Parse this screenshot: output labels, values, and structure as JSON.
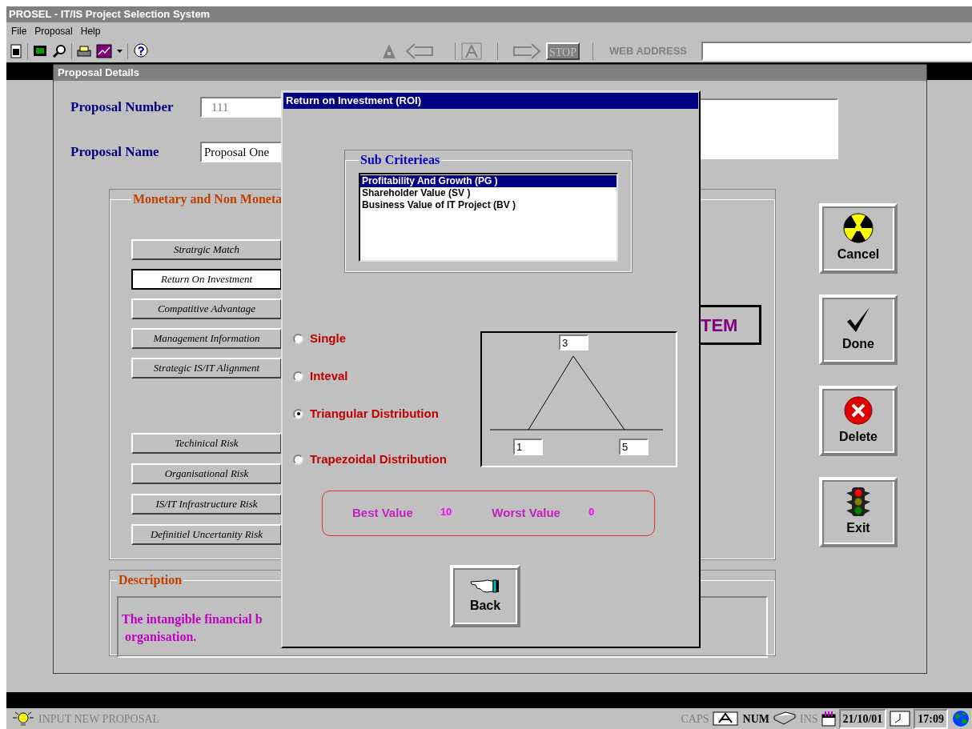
{
  "window": {
    "title": "PROSEL - IT/IS Project Selection System"
  },
  "menu": [
    {
      "label": "File"
    },
    {
      "label": "Proposal"
    },
    {
      "label": "Help"
    }
  ],
  "toolbar": {
    "stop_button": "STOP",
    "web_address_label": "WEB ADDRESS"
  },
  "proposal_window": {
    "title": "Proposal Details",
    "fields": [
      {
        "label": "Proposal Number",
        "value": "111",
        "disabled": true
      },
      {
        "label": "Proposal Name",
        "value": "Proposal One",
        "disabled": false
      }
    ],
    "criteria_group": {
      "title": "Monetary and Non Moneta",
      "benefit_buttons": [
        {
          "label": "Stratrgic Match",
          "selected": false
        },
        {
          "label": "Return On Investment",
          "selected": true
        },
        {
          "label": "Compatitive Advantage",
          "selected": false
        },
        {
          "label": "Management Information",
          "selected": false
        },
        {
          "label": "Strategic IS/IT Alignment",
          "selected": false
        }
      ],
      "risk_buttons": [
        {
          "label": "Techinical Risk",
          "selected": false
        },
        {
          "label": "Organisational Risk",
          "selected": false
        },
        {
          "label": "IS/IT Infrastructure Risk",
          "selected": false
        },
        {
          "label": "Definitiel Uncertanity Risk",
          "selected": false
        }
      ],
      "banner_text": "TEM"
    },
    "description": {
      "title": "Description",
      "lines": [
        "The intangible financial b",
        "organisation."
      ]
    },
    "actions": [
      {
        "label": "Cancel",
        "kind": "cancel"
      },
      {
        "label": "Done",
        "kind": "done"
      },
      {
        "label": "Delete",
        "kind": "delete"
      },
      {
        "label": "Exit",
        "kind": "exit"
      }
    ]
  },
  "dialog": {
    "title": "Return on Investment (ROI)",
    "sub_criteria": {
      "title": "Sub Criterieas",
      "items": [
        {
          "label": "Profitability And Growth (PG )",
          "selected": true
        },
        {
          "label": "Shareholder Value (SV )",
          "selected": false
        },
        {
          "label": "Business Value of IT Project (BV )",
          "selected": false
        }
      ]
    },
    "distribution_options": [
      {
        "label": "Single",
        "selected": false
      },
      {
        "label": "Inteval",
        "selected": false
      },
      {
        "label": "Triangular Distribution",
        "selected": true
      },
      {
        "label": "Trapezoidal Distribution",
        "selected": false
      }
    ],
    "triangle": {
      "peak": "3",
      "low": "1",
      "high": "5"
    },
    "best_label": "Best Value",
    "best_value": "10",
    "worst_label": "Worst Value",
    "worst_value": "0",
    "back_button": "Back"
  },
  "status_bar": {
    "message": "INPUT NEW PROPOSAL",
    "indicators": [
      {
        "label": "CAPS",
        "on": false
      },
      {
        "label": "NUM",
        "on": true
      },
      {
        "label": "INS",
        "on": false
      }
    ],
    "date": "21/10/01",
    "time": "17:09"
  }
}
